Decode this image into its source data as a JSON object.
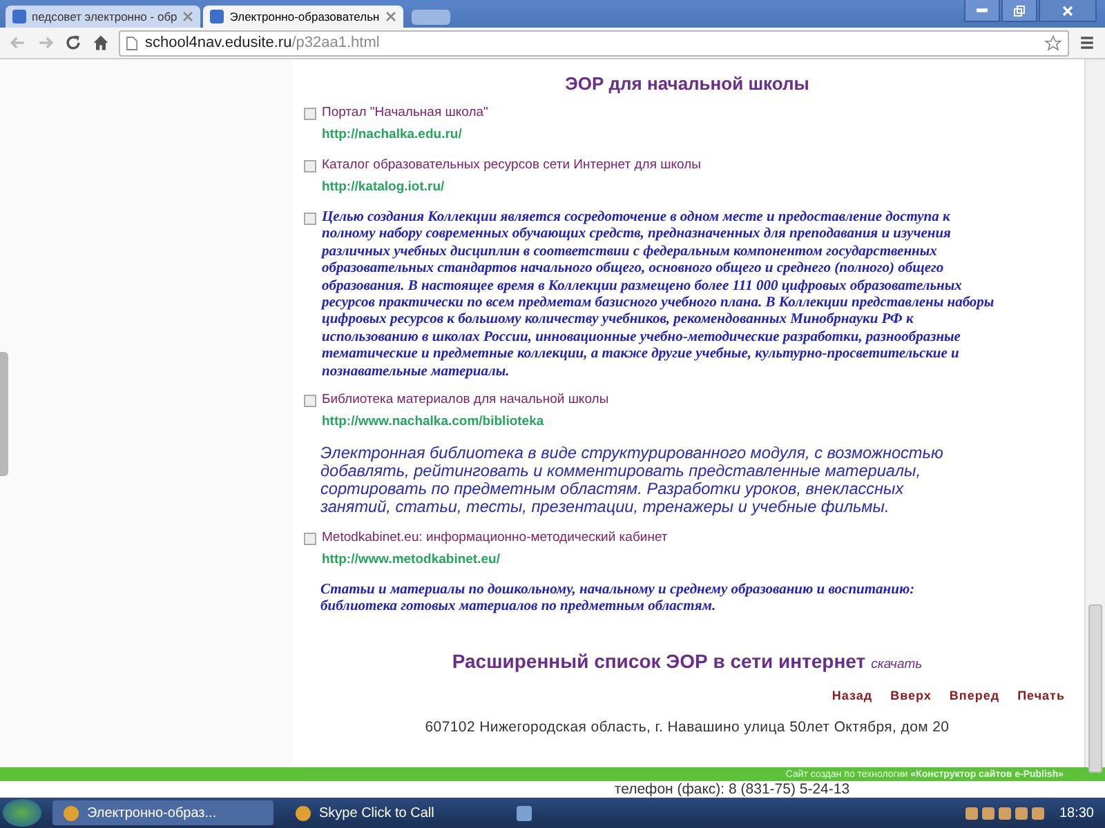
{
  "browser": {
    "tabs": [
      {
        "title": "педсовет электронно - обр",
        "selected": false
      },
      {
        "title": "Электронно-образовательн",
        "selected": true
      }
    ],
    "address": {
      "host": "school4nav.edusite.ru",
      "path": "/p32aa1.html"
    }
  },
  "page": {
    "heading": "ЭОР для начальной школы",
    "items": [
      {
        "kind": "link",
        "title": " Портал \"Начальная школа\"",
        "url": "http://nachalka.edu.ru/"
      },
      {
        "kind": "link",
        "title": "Каталог образовательных ресурсов сети Интернет для школы",
        "url": "http://katalog.iot.ru/"
      },
      {
        "kind": "bullet-note",
        "text": "Целью создания Коллекции является сосредоточение в одном месте и предоставление доступа к полному набору современных обучающих средств, предназначенных для преподавания и изучения различных учебных дисциплин в соответствии с федеральным компонентом государственных образовательных стандартов начального общего, основного общего и среднего (полного) общего образования. В настоящее время в Коллекции размещено более 111 000 цифровых образовательных ресурсов практически по всем предметам базисного учебного плана. В Коллекции представлены наборы цифровых ресурсов к большому количеству учебников, рекомендованных Минобрнауки РФ к использованию в школах России, инновационные учебно-методические разработки, разнообразные тематические и предметные коллекции, а также другие учебные, культурно-просветительские и познавательные материалы."
      },
      {
        "kind": "link",
        "title": "Библиотека материалов для начальной школы",
        "url": "http://www.nachalka.com/biblioteka"
      },
      {
        "kind": "blurb",
        "text": "Электронная библиотека в виде структурированного модуля, с возможностью добавлять, рейтинговать и комментировать представленные материалы, сортировать по предметным областям. Разработки уроков, внеклассных занятий, статьи, тесты, презентации, тренажеры и учебные фильмы."
      },
      {
        "kind": "link",
        "title": "Metodkabinet.eu: информационно-методический кабинет",
        "url": "http://www.metodkabinet.eu/"
      },
      {
        "kind": "note",
        "text": "Статьи и материалы по дошкольному, начальному и среднему образованию и воспитанию: библиотека готовых материалов по предметным областям."
      }
    ],
    "extended": {
      "title": "Расширенный список ЭОР в сети интернет",
      "link": "скачать"
    },
    "nav": [
      "Назад",
      "Вверх",
      "Вперед",
      "Печать"
    ],
    "address": "607102 Нижегородская область, г. Навашино улица 50лет Октября, дом 20",
    "credit": "Сайт создан по технологии **«Конструктор сайтов e-Publish»**",
    "phone": "телефон (факс): 8 (831-75) 5-24-13"
  },
  "taskbar": {
    "apps": [
      {
        "label": "Электронно-образ...",
        "selected": true
      },
      {
        "label": "Skype Click to Call",
        "selected": false
      }
    ],
    "clock": "18:30"
  }
}
